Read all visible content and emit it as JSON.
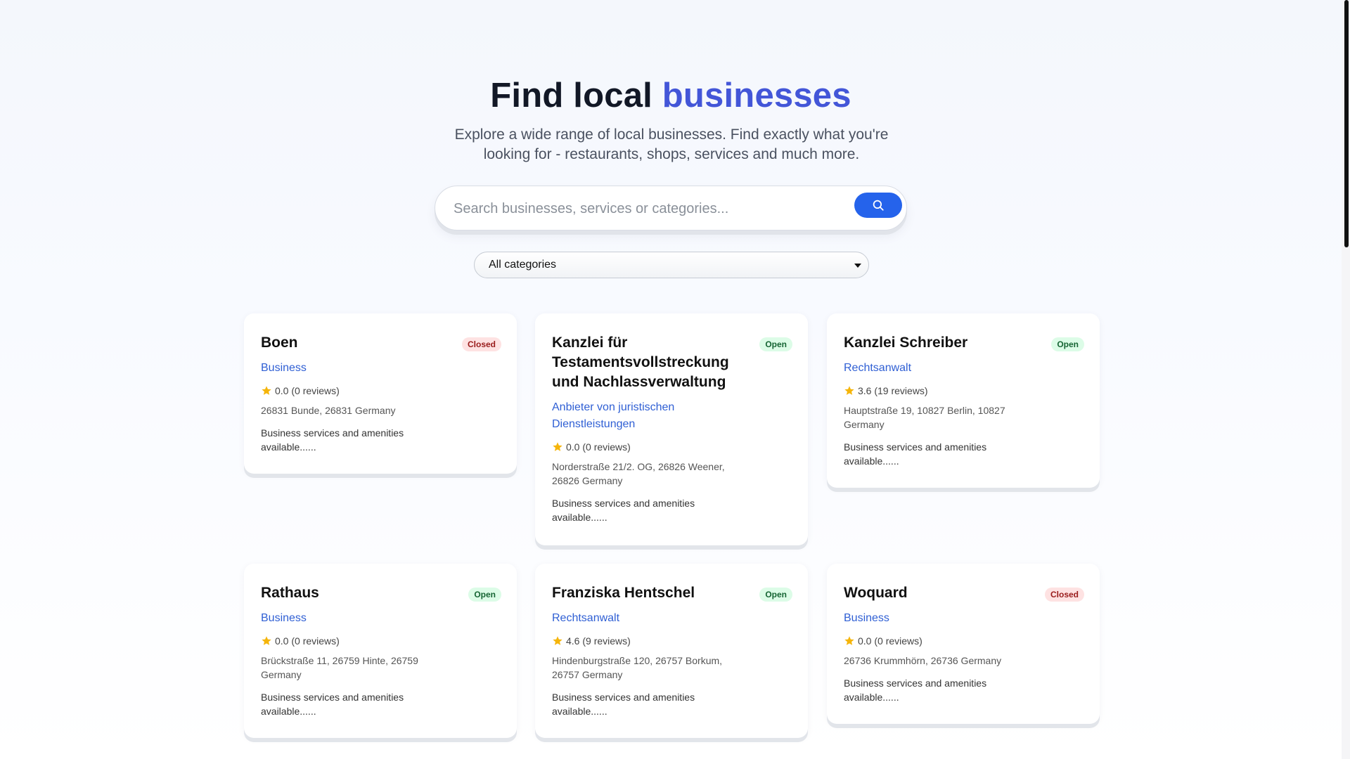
{
  "hero": {
    "title_main": "Find local ",
    "title_accent": "businesses",
    "subtitle": "Explore a wide range of local businesses. Find exactly what you're looking for - restaurants, shops, services and much more."
  },
  "search": {
    "placeholder": "Search businesses, services or categories...",
    "button_icon": "search-icon"
  },
  "filter": {
    "selected_category": "All categories"
  },
  "colors": {
    "accent": "#4356d8",
    "search_button": "#2563eb",
    "open_badge_bg": "#dcfce7",
    "closed_badge_bg": "#fee2e2",
    "star": "#f5b50a"
  },
  "businesses": [
    {
      "name": "Boen",
      "status": "Closed",
      "category": "Business",
      "rating": "0.0 (0 reviews)",
      "address": "26831 Bunde, 26831 Germany",
      "description": "Business services and amenities available......"
    },
    {
      "name": "Kanzlei für Testamentsvollstreckung und Nachlassverwaltung",
      "status": "Open",
      "category": "Anbieter von juristischen Dienstleistungen",
      "rating": "0.0 (0 reviews)",
      "address": "Norderstraße 21/2. OG, 26826 Weener, 26826 Germany",
      "description": "Business services and amenities available......"
    },
    {
      "name": "Kanzlei Schreiber",
      "status": "Open",
      "category": "Rechtsanwalt",
      "rating": "3.6 (19 reviews)",
      "address": "Hauptstraße 19, 10827 Berlin, 10827 Germany",
      "description": "Business services and amenities available......"
    },
    {
      "name": "Rathaus",
      "status": "Open",
      "category": "Business",
      "rating": "0.0 (0 reviews)",
      "address": "Brückstraße 11, 26759 Hinte, 26759 Germany",
      "description": "Business services and amenities available......"
    },
    {
      "name": "Franziska Hentschel",
      "status": "Open",
      "category": "Rechtsanwalt",
      "rating": "4.6 (9 reviews)",
      "address": "Hindenburgstraße 120, 26757 Borkum, 26757 Germany",
      "description": "Business services and amenities available......"
    },
    {
      "name": "Woquard",
      "status": "Closed",
      "category": "Business",
      "rating": "0.0 (0 reviews)",
      "address": "26736 Krummhörn, 26736 Germany",
      "description": "Business services and amenities available......"
    }
  ]
}
